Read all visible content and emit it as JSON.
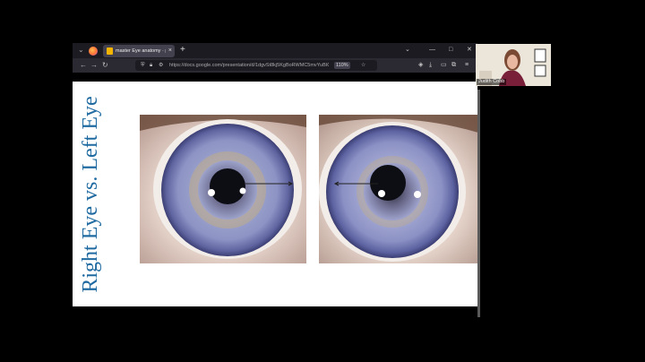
{
  "browser": {
    "tab_title": "master Eye anatomy · promo...",
    "url": "https://docs.google.com/presentation/d/1dgvSt8kj5KgBoRWMC5mvYuBIOSDKe7?gyN8tg62/...",
    "zoom": "110%"
  },
  "slide": {
    "title": "Right Eye vs. Left Eye"
  },
  "webcam": {
    "name": "Judith Cobb"
  },
  "icons": [
    "firefox-logo-icon",
    "tab-list-icon",
    "new-tab-icon",
    "minimize-icon",
    "maximize-icon",
    "close-icon",
    "back-icon",
    "forward-icon",
    "reload-icon",
    "shield-icon",
    "lock-icon",
    "permissions-icon",
    "bookmark-star-icon",
    "pocket-icon",
    "download-icon",
    "sidebar-icon",
    "extensions-icon",
    "menu-icon"
  ]
}
